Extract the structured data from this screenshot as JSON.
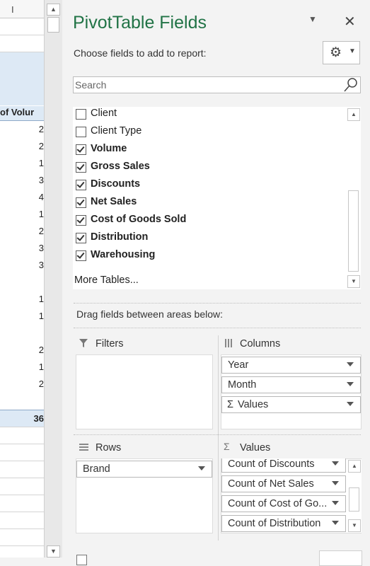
{
  "grid": {
    "column_label": "I",
    "header_text": "of Volur",
    "cell_values": [
      "2",
      "2",
      "1",
      "3",
      "4",
      "1",
      "2",
      "3",
      "3",
      "1",
      "1",
      "2",
      "1",
      "2"
    ],
    "total_value": "36"
  },
  "pane": {
    "title": "PivotTable Fields",
    "choose_label": "Choose fields to add to report:",
    "search_placeholder": "Search",
    "fields": [
      {
        "label": "Client",
        "checked": false
      },
      {
        "label": "Client Type",
        "checked": false
      },
      {
        "label": "Volume",
        "checked": true
      },
      {
        "label": "Gross Sales",
        "checked": true
      },
      {
        "label": "Discounts",
        "checked": true
      },
      {
        "label": "Net Sales",
        "checked": true
      },
      {
        "label": "Cost of Goods Sold",
        "checked": true
      },
      {
        "label": "Distribution",
        "checked": true
      },
      {
        "label": "Warehousing",
        "checked": true
      }
    ],
    "more_tables": "More Tables...",
    "drag_label": "Drag fields between areas below:",
    "areas": {
      "filters": {
        "label": "Filters",
        "items": []
      },
      "columns": {
        "label": "Columns",
        "items": [
          "Year",
          "Month",
          "Values"
        ]
      },
      "rows": {
        "label": "Rows",
        "items": [
          "Brand"
        ]
      },
      "values": {
        "label": "Values",
        "items": [
          "Count of Discounts",
          "Count of Net Sales",
          "Count of Cost of Go...",
          "Count of Distribution"
        ]
      }
    }
  },
  "colors": {
    "title_green": "#217346",
    "selection_blue": "#dde9f5"
  }
}
